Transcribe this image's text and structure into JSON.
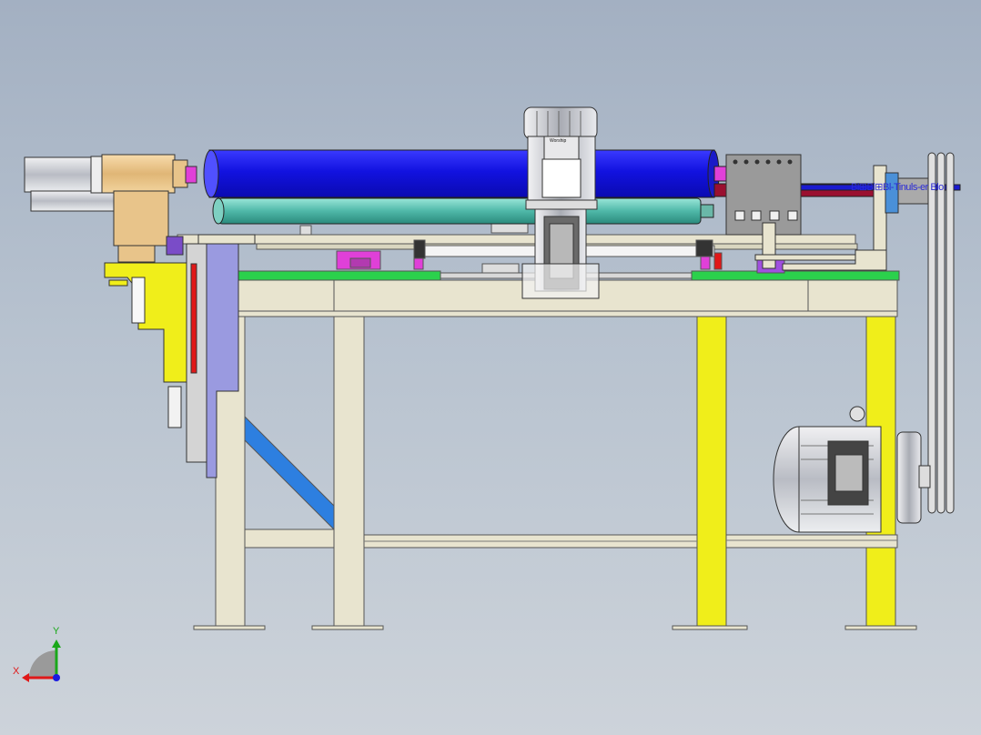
{
  "viewport": {
    "overlapping_text": "Bl⊞Bl⊞Bl-Tinuls-er Blo",
    "motor_brand": "Worship",
    "axes": {
      "x_label": "X",
      "y_label": "Y"
    }
  },
  "colors": {
    "background_top": "#a3b0c2",
    "background_bottom": "#cdd3da",
    "frame": "#e8e4cf",
    "roller_blue": "#1414e6",
    "roller_teal": "#4fb8a8",
    "yellow": "#f0ee1a",
    "green_plate": "#2bd14c",
    "purple": "#7a4cc8",
    "magenta": "#e040d8",
    "motor_grey": "#c8cad0",
    "brace_blue": "#2d7fe0",
    "tan": "#e8c48a"
  },
  "icons": [
    "cad-triad-icon"
  ]
}
